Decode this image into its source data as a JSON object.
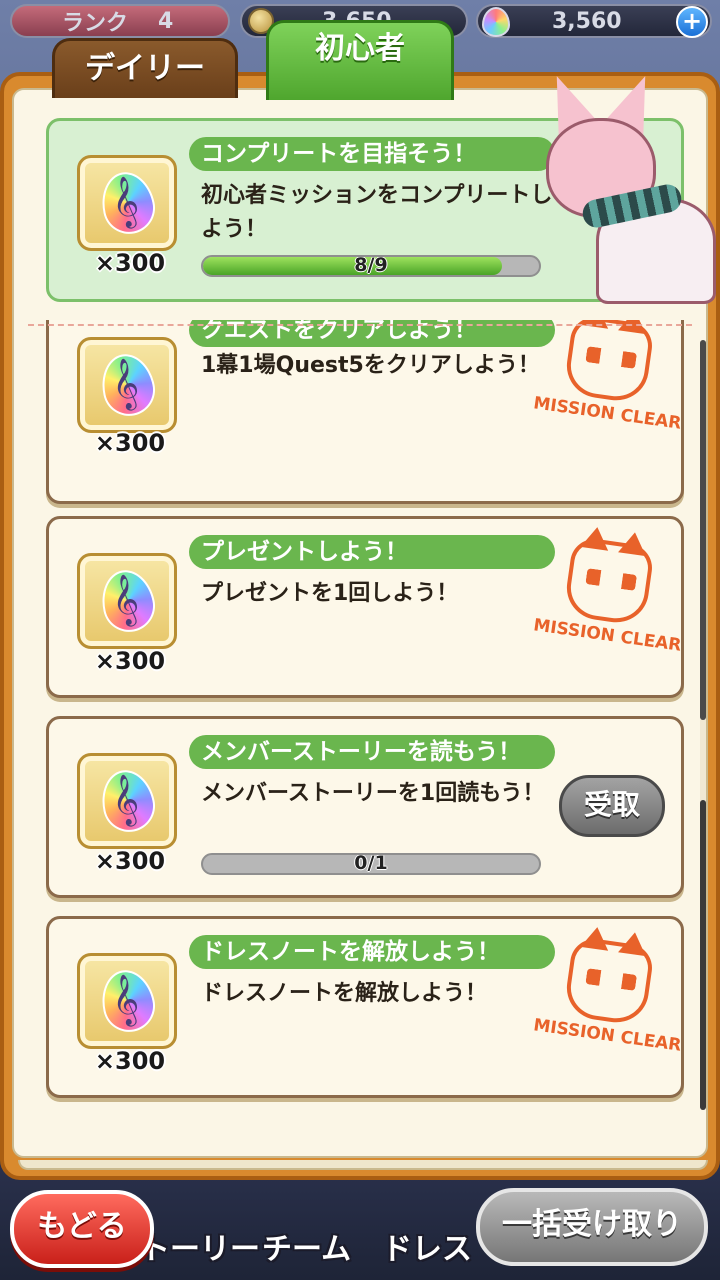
{
  "status": {
    "rank_label": "ランク",
    "rank_value": "4",
    "coins": "3,650",
    "gems": "3,560",
    "plus_icon": "plus-icon"
  },
  "tabs": [
    {
      "label": "デイリー",
      "active": false
    },
    {
      "label": "初心者",
      "active": true
    }
  ],
  "missions": [
    {
      "title": "コンプリートを目指そう！",
      "desc": "初心者ミッションをコンプリートしよう！",
      "reward_qty": "×300",
      "progress_text": "8/9",
      "progress": 0.89,
      "status": "in_progress",
      "highlight": true
    },
    {
      "title": "クエストをクリアしよう！",
      "desc": "1幕1場Quest5をクリアしよう！",
      "reward_qty": "×300",
      "status": "cleared",
      "stamp": "MISSION CLEAR"
    },
    {
      "title": "プレゼントしよう！",
      "desc": "プレゼントを1回しよう！",
      "reward_qty": "×300",
      "status": "cleared",
      "stamp": "MISSION CLEAR"
    },
    {
      "title": "メンバーストーリーを読もう！",
      "desc": "メンバーストーリーを1回読もう！",
      "reward_qty": "×300",
      "progress_text": "0/1",
      "progress": 0.0,
      "status": "claimable",
      "claim_label": "受取"
    },
    {
      "title": "ドレスノートを解放しよう！",
      "desc": "ドレスノートを解放しよう！",
      "reward_qty": "×300",
      "status": "cleared",
      "stamp": "MISSION CLEAR"
    }
  ],
  "bottom_nav": {
    "back_label": "もどる",
    "items": [
      "トーリー",
      "チーム",
      "ドレス"
    ],
    "claim_all_label": "一括受け取り"
  }
}
